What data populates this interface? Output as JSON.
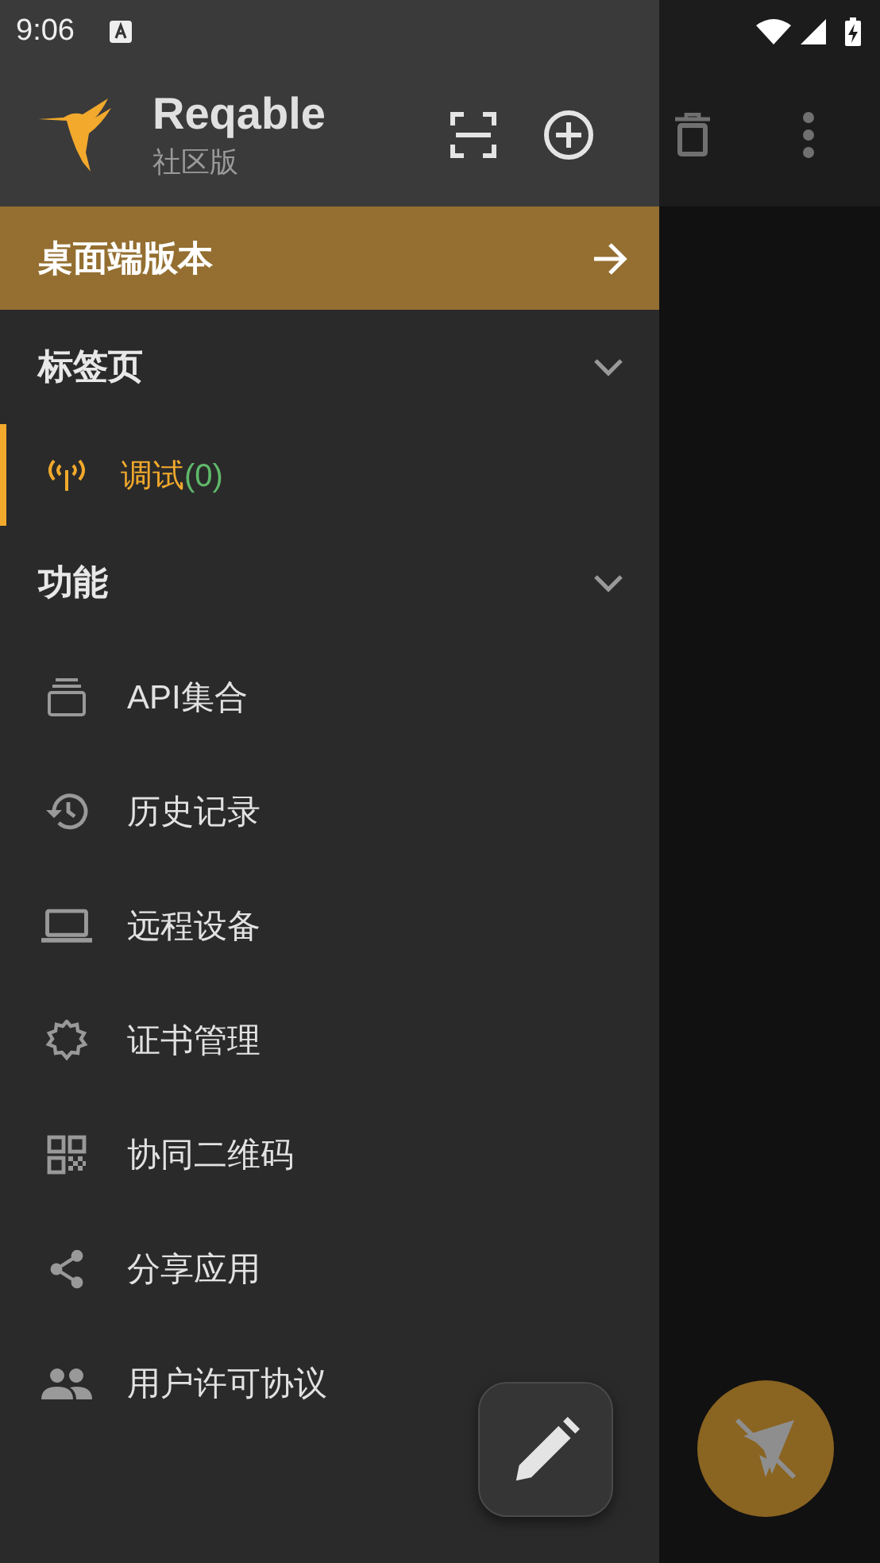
{
  "status_bar": {
    "time": "9:06"
  },
  "drawer": {
    "app_name": "Reqable",
    "edition": "社区版",
    "banner": "桌面端版本",
    "sections": [
      {
        "title": "标签页",
        "expanded": true,
        "items": [
          {
            "kind": "tab",
            "label": "调试",
            "count": "(0)",
            "selected": true
          }
        ]
      },
      {
        "title": "功能",
        "expanded": true,
        "items": [
          {
            "kind": "link",
            "label": "API集合"
          },
          {
            "kind": "link",
            "label": "历史记录"
          },
          {
            "kind": "link",
            "label": "远程设备"
          },
          {
            "kind": "link",
            "label": "证书管理"
          },
          {
            "kind": "link",
            "label": "协同二维码"
          },
          {
            "kind": "link",
            "label": "分享应用"
          },
          {
            "kind": "link",
            "label": "用户许可协议"
          }
        ]
      }
    ]
  }
}
